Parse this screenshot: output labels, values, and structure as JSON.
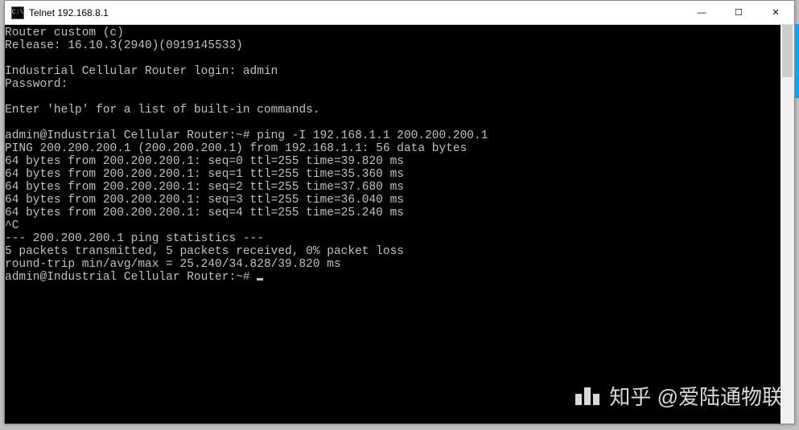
{
  "window": {
    "icon_text": "C:\\",
    "title": "Telnet 192.168.8.1",
    "controls": {
      "min": "—",
      "max": "☐",
      "close": "✕"
    }
  },
  "terminal": {
    "lines": [
      "Router custom (c)",
      "Release: 16.10.3(2940)(0919145533)",
      "",
      "Industrial Cellular Router login: admin",
      "Password:",
      "",
      "Enter 'help' for a list of built-in commands.",
      "",
      "admin@Industrial Cellular Router:~# ping -I 192.168.1.1 200.200.200.1",
      "PING 200.200.200.1 (200.200.200.1) from 192.168.1.1: 56 data bytes",
      "64 bytes from 200.200.200.1: seq=0 ttl=255 time=39.820 ms",
      "64 bytes from 200.200.200.1: seq=1 ttl=255 time=35.360 ms",
      "64 bytes from 200.200.200.1: seq=2 ttl=255 time=37.680 ms",
      "64 bytes from 200.200.200.1: seq=3 ttl=255 time=36.040 ms",
      "64 bytes from 200.200.200.1: seq=4 ttl=255 time=25.240 ms",
      "^C",
      "--- 200.200.200.1 ping statistics ---",
      "5 packets transmitted, 5 packets received, 0% packet loss",
      "round-trip min/avg/max = 25.240/34.828/39.820 ms",
      "admin@Industrial Cellular Router:~# "
    ],
    "has_cursor": true
  },
  "watermark": "知乎 @爱陆通物联"
}
